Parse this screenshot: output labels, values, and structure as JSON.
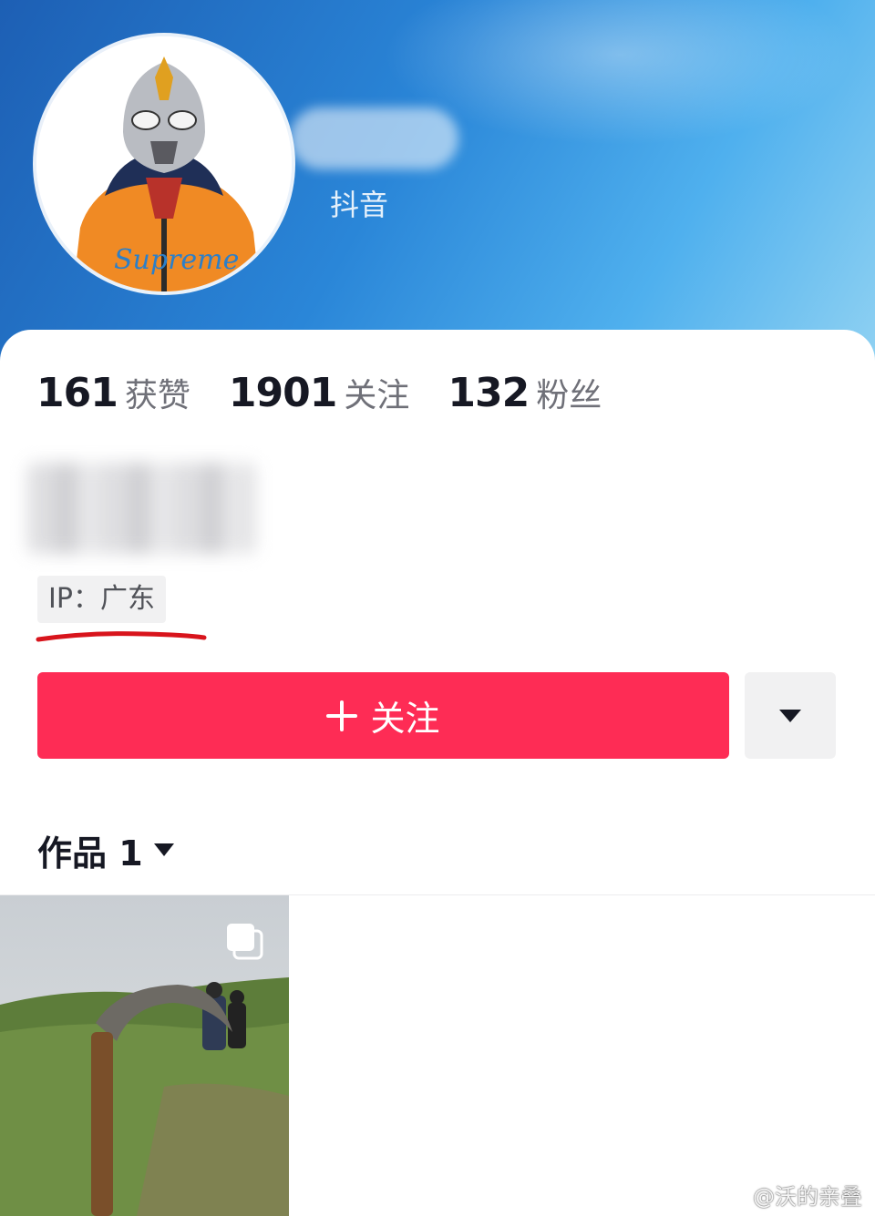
{
  "header": {
    "douyin_id_label": "抖音",
    "accent_color": "#2a86d8"
  },
  "stats": [
    {
      "value": "161",
      "label": "获赞"
    },
    {
      "value": "1901",
      "label": "关注"
    },
    {
      "value": "132",
      "label": "粉丝"
    }
  ],
  "ip": {
    "label": "IP：广东"
  },
  "actions": {
    "follow_label": "关注",
    "follow_color": "#fe2c55"
  },
  "tabs": {
    "works_label": "作品 1"
  },
  "watermark": {
    "text": "@沃的亲叠"
  }
}
